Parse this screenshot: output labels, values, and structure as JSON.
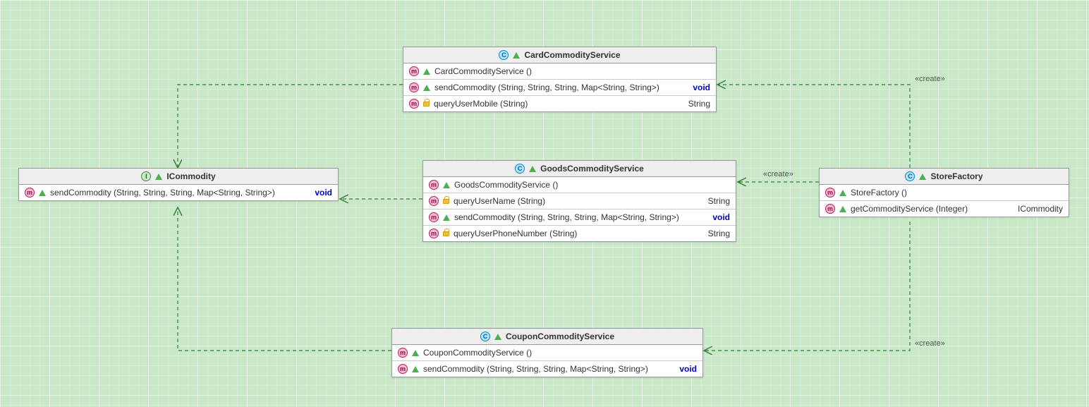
{
  "classes": {
    "ICommodity": {
      "name": "ICommodity",
      "type": "interface",
      "members": [
        {
          "name": "sendCommodity",
          "params": "(String, String, String, Map<String, String>)",
          "ret": "void",
          "vis": "public"
        }
      ]
    },
    "CardCommodityService": {
      "name": "CardCommodityService",
      "type": "class",
      "members": [
        {
          "name": "CardCommodityService",
          "params": "()",
          "ret": "",
          "vis": "public"
        },
        {
          "name": "sendCommodity",
          "params": "(String, String, String, Map<String, String>)",
          "ret": "void",
          "vis": "public"
        },
        {
          "name": "queryUserMobile",
          "params": "(String)",
          "ret": "String",
          "vis": "private"
        }
      ]
    },
    "GoodsCommodityService": {
      "name": "GoodsCommodityService",
      "type": "class",
      "members": [
        {
          "name": "GoodsCommodityService",
          "params": "()",
          "ret": "",
          "vis": "public"
        },
        {
          "name": "queryUserName",
          "params": "(String)",
          "ret": "String",
          "vis": "private"
        },
        {
          "name": "sendCommodity",
          "params": "(String, String, String, Map<String, String>)",
          "ret": "void",
          "vis": "public"
        },
        {
          "name": "queryUserPhoneNumber",
          "params": "(String)",
          "ret": "String",
          "vis": "private"
        }
      ]
    },
    "CouponCommodityService": {
      "name": "CouponCommodityService",
      "type": "class",
      "members": [
        {
          "name": "CouponCommodityService",
          "params": "()",
          "ret": "",
          "vis": "public"
        },
        {
          "name": "sendCommodity",
          "params": "(String, String, String, Map<String, String>)",
          "ret": "void",
          "vis": "public"
        }
      ]
    },
    "StoreFactory": {
      "name": "StoreFactory",
      "type": "class",
      "members": [
        {
          "name": "StoreFactory",
          "params": "()",
          "ret": "",
          "vis": "public"
        },
        {
          "name": "getCommodityService",
          "params": "(Integer)",
          "ret": "ICommodity",
          "vis": "public"
        }
      ]
    }
  },
  "stereotypes": {
    "create1": "«create»",
    "create2": "«create»",
    "create3": "«create»"
  }
}
